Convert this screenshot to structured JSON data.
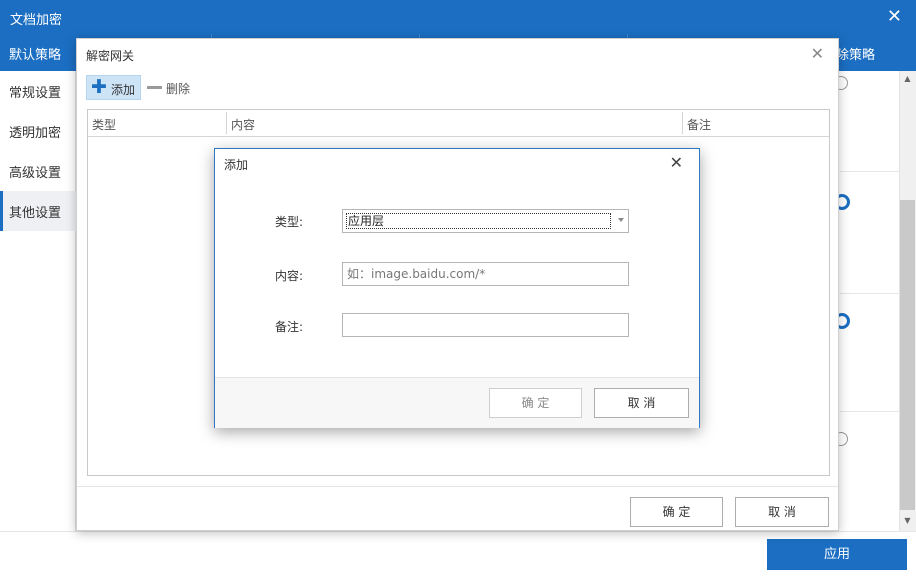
{
  "window": {
    "title": "文档加密",
    "close_icon": "close-icon"
  },
  "tabs": {
    "active": "默认策略",
    "right_partial": "除策略"
  },
  "sidebar": {
    "items": [
      {
        "label": "常规设置"
      },
      {
        "label": "透明加密"
      },
      {
        "label": "高级设置"
      },
      {
        "label": "其他设置",
        "active": true
      }
    ]
  },
  "apply_label": "应用",
  "gateway_dialog": {
    "title": "解密网关",
    "add_label": "添加",
    "delete_label": "删除",
    "columns": [
      "类型",
      "内容",
      "备注"
    ],
    "ok_label": "确 定",
    "cancel_label": "取 消"
  },
  "add_dialog": {
    "title": "添加",
    "type_label": "类型:",
    "type_value": "应用层",
    "content_label": "内容:",
    "content_placeholder": "如：image.baidu.com/*",
    "note_label": "备注:",
    "ok_label": "确 定",
    "cancel_label": "取 消"
  },
  "colors": {
    "accent": "#1b6ec2"
  }
}
